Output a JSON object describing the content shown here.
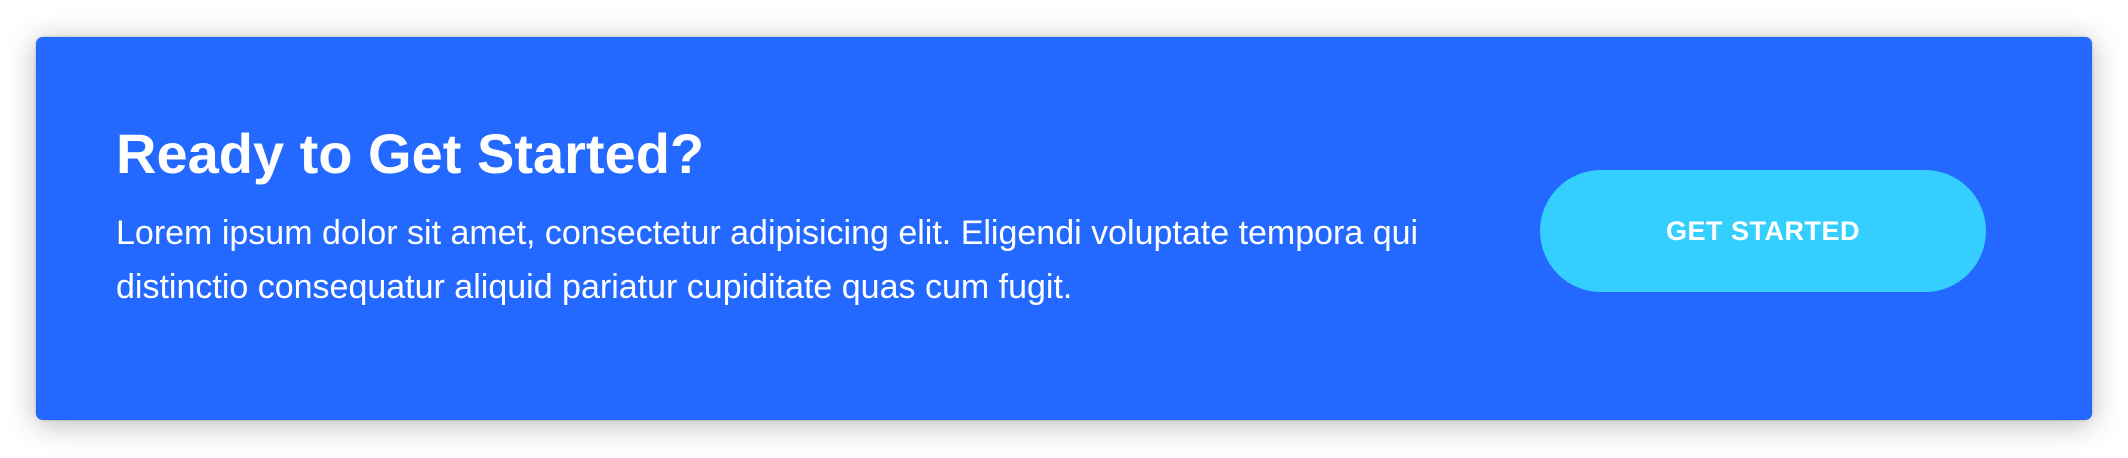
{
  "cta": {
    "title": "Ready to Get Started?",
    "body": "Lorem ipsum dolor sit amet, consectetur adipisicing elit. Eligendi voluptate tempora qui distinctio consequatur aliquid pariatur cupiditate quas cum fugit.",
    "button_label": "GET STARTED"
  },
  "colors": {
    "card_background": "#2369ff",
    "button_background": "#35cfff",
    "text": "#ffffff"
  }
}
